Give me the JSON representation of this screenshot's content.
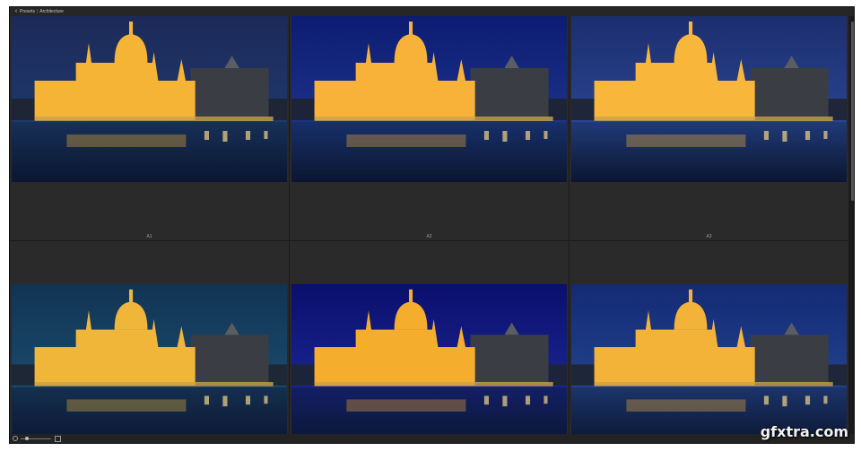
{
  "topbar": {
    "back_glyph": "‹",
    "breadcrumb": [
      "Presets",
      "Architecture"
    ]
  },
  "grid": {
    "presets": [
      {
        "label": "A1",
        "sky": "#1c2a58",
        "sky_low": "#1f386d",
        "water": "#173057",
        "glow": "#f6b437"
      },
      {
        "label": "A2",
        "sky": "#0c1c72",
        "sky_low": "#1d3289",
        "water": "#17306a",
        "glow": "#f8b23a"
      },
      {
        "label": "A3",
        "sky": "#1c2e6e",
        "sky_low": "#2a4490",
        "water": "#203a78",
        "glow": "#f8b73a"
      },
      {
        "label": "",
        "sky": "#123454",
        "sky_low": "#1a4a6c",
        "water": "#152f4f",
        "glow": "#efb63a"
      },
      {
        "label": "",
        "sky": "#0a0f6c",
        "sky_low": "#1a2590",
        "water": "#131f66",
        "glow": "#f5ad2e"
      },
      {
        "label": "",
        "sky": "#142a74",
        "sky_low": "#22428e",
        "water": "#1b346a",
        "glow": "#f3b238"
      }
    ]
  },
  "zoom": {
    "level": 0.15
  },
  "watermark": {
    "text": "gfxtra.com"
  }
}
